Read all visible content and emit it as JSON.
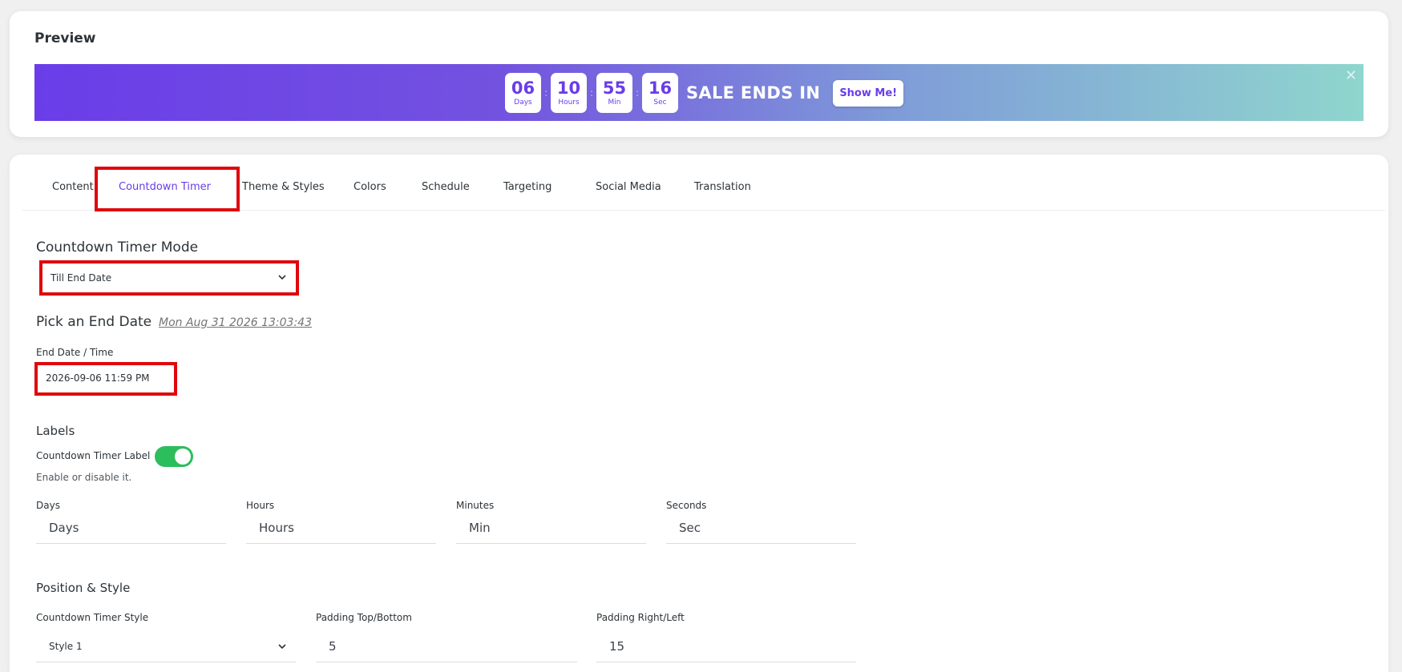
{
  "preview": {
    "title": "Preview",
    "timer": [
      {
        "value": "06",
        "label": "Days"
      },
      {
        "value": "10",
        "label": "Hours"
      },
      {
        "value": "55",
        "label": "Min"
      },
      {
        "value": "16",
        "label": "Sec"
      }
    ],
    "separator": ":",
    "headline": "SALE ENDS IN",
    "button_label": "Show Me!",
    "close_glyph": "✕"
  },
  "tabs": [
    {
      "label": "Content"
    },
    {
      "label": "Countdown Timer",
      "active": true
    },
    {
      "label": "Theme & Styles"
    },
    {
      "label": "Colors"
    },
    {
      "label": "Schedule"
    },
    {
      "label": "Targeting"
    },
    {
      "label": "Social Media"
    },
    {
      "label": "Translation"
    }
  ],
  "timer_mode": {
    "heading": "Countdown Timer Mode",
    "selected": "Till End Date"
  },
  "end_date": {
    "heading": "Pick an End Date",
    "current_date": "Mon Aug 31 2026 13:03:43",
    "field_label": "End Date / Time",
    "value": "2026-09-06 11:59 PM"
  },
  "labels": {
    "heading": "Labels",
    "toggle_label": "Countdown Timer Label",
    "toggle_on": true,
    "hint": "Enable or disable it.",
    "fields": [
      {
        "label": "Days",
        "value": "Days"
      },
      {
        "label": "Hours",
        "value": "Hours"
      },
      {
        "label": "Minutes",
        "value": "Min"
      },
      {
        "label": "Seconds",
        "value": "Sec"
      }
    ]
  },
  "position_style": {
    "heading": "Position & Style",
    "style_label": "Countdown Timer Style",
    "style_value": "Style 1",
    "padding_tb_label": "Padding Top/Bottom",
    "padding_tb_value": "5",
    "padding_rl_label": "Padding Right/Left",
    "padding_rl_value": "15"
  },
  "colors": {
    "accent": "#6a3de8",
    "toggle": "#2cbd5c",
    "highlight": "#e0070c"
  },
  "icons": {
    "select_arrow": "chevron-down-icon",
    "close": "close-icon"
  }
}
